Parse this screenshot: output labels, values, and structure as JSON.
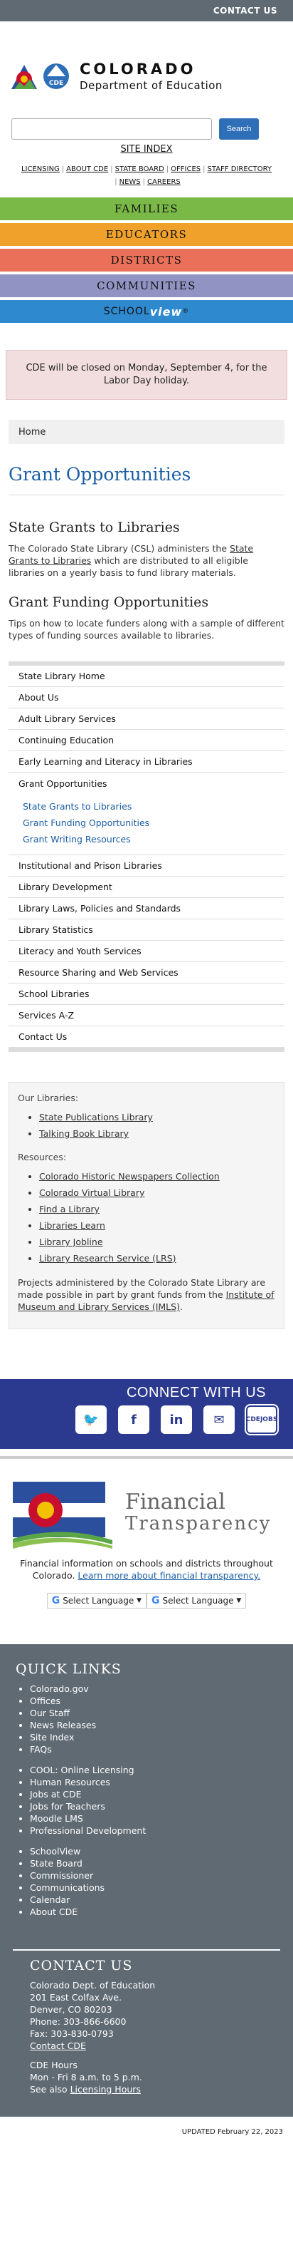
{
  "topbar": {
    "contact_us": "CONTACT US"
  },
  "logo": {
    "line1": "COLORADO",
    "line2": "Department of Education",
    "seal_text": "CDE"
  },
  "search": {
    "button": "Search",
    "placeholder": ""
  },
  "site_index": "SITE INDEX",
  "util_links": [
    "LICENSING",
    "ABOUT CDE",
    "STATE BOARD",
    "OFFICES",
    "STAFF DIRECTORY",
    "NEWS",
    "CAREERS"
  ],
  "nav": {
    "families": "FAMILIES",
    "educators": "EDUCATORS",
    "districts": "DISTRICTS",
    "communities": "COMMUNITIES",
    "schoolview_a": "SCHOOL",
    "schoolview_b": "view",
    "schoolview_tm": "®"
  },
  "alert": "CDE will be closed on Monday, September 4, for the Labor Day holiday.",
  "breadcrumb": "Home",
  "page_title": "Grant Opportunities",
  "section1": {
    "heading": "State Grants to Libraries",
    "text_a": "The Colorado State Library (CSL) administers the ",
    "link": "State Grants to Libraries",
    "text_b": " which are distributed to all eligible libraries on a yearly basis to fund library materials."
  },
  "section2": {
    "heading": "Grant Funding Opportunities",
    "text": "Tips on how to locate funders along with a sample of different types of funding sources available to libraries."
  },
  "sidenav": {
    "items_before": [
      "State Library Home",
      "About Us",
      "Adult Library Services",
      "Continuing Education",
      "Early Learning and Literacy in Libraries"
    ],
    "active": "Grant Opportunities",
    "subitems": [
      "State Grants to Libraries",
      "Grant Funding Opportunities",
      "Grant Writing Resources"
    ],
    "items_after": [
      "Institutional and Prison Libraries",
      "Library Development",
      "Library Laws, Policies and Standards",
      "Library Statistics",
      "Literacy and Youth Services",
      "Resource Sharing and Web Services",
      "School Libraries",
      "Services A-Z",
      "Contact Us"
    ]
  },
  "resources": {
    "our_libraries_label": "Our Libraries:",
    "our_libraries": [
      "State Publications Library",
      "Talking Book Library"
    ],
    "resources_label": "Resources:",
    "resources": [
      "Colorado Historic Newspapers Collection",
      "Colorado Virtual Library",
      "Find a Library",
      "Libraries Learn",
      "Library Jobline",
      "Library Research Service (LRS)"
    ],
    "note_a": "Projects administered by the Colorado State Library are made possible in part by grant funds from the ",
    "note_link": "Institute of Museum and Library Services (IMLS)",
    "note_b": "."
  },
  "connect": {
    "heading": "CONNECT WITH US",
    "icons": [
      "twitter-icon",
      "facebook-icon",
      "linkedin-icon",
      "email-icon",
      "cde-jobs-icon"
    ],
    "glyph_twitter": "🐦",
    "glyph_facebook": "f",
    "glyph_linkedin": "in",
    "glyph_email": "✉",
    "jobs_a": "CDE",
    "jobs_b": "JOBS"
  },
  "financial": {
    "line1": "Financial",
    "line2": "Transparency",
    "desc": "Financial information on schools and districts throughout Colorado. ",
    "link": "Learn more about financial transparency."
  },
  "language": {
    "label": "Select Language",
    "g": "G",
    "arrow": "▼"
  },
  "quick_links": {
    "heading": "QUICK LINKS",
    "group1": [
      "Colorado.gov",
      "Offices",
      "Our Staff",
      "News Releases",
      "Site Index",
      "FAQs"
    ],
    "group2": [
      "COOL: Online Licensing",
      "Human Resources",
      "Jobs at CDE",
      "Jobs for Teachers",
      "Moodle LMS",
      "Professional Development"
    ],
    "group3": [
      "SchoolView",
      "State Board",
      "Commissioner",
      "Communications",
      "Calendar",
      "About CDE"
    ]
  },
  "contact": {
    "heading": "CONTACT US",
    "lines": [
      "Colorado Dept. of Education",
      "201 East Colfax Ave.",
      "Denver, CO 80203",
      "Phone: 303-866-6600",
      "Fax: 303-830-0793"
    ],
    "link": "Contact CDE",
    "hours_label": "CDE Hours",
    "hours": "Mon - Fri 8 a.m. to 5 p.m.",
    "see_also": "See also ",
    "see_also_link": "Licensing Hours"
  },
  "updated": "UPDATED February 22, 2023"
}
